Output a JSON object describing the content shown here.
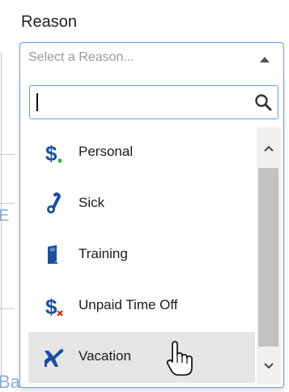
{
  "field": {
    "label": "Reason",
    "placeholder": "Select a Reason..."
  },
  "search": {
    "value": "",
    "icon": "search-icon"
  },
  "options": [
    {
      "label": "Personal",
      "icon": "dollar-dot-icon"
    },
    {
      "label": "Sick",
      "icon": "thermometer-icon"
    },
    {
      "label": "Training",
      "icon": "book-icon"
    },
    {
      "label": "Unpaid Time Off",
      "icon": "dollar-x-icon"
    },
    {
      "label": "Vacation",
      "icon": "airplane-icon",
      "hovered": true
    }
  ],
  "colors": {
    "accent": "#5aa0e8",
    "icon_blue": "#1b4f9c",
    "green_dot": "#3cb043",
    "red_x": "#d9261c",
    "hover_bg": "#e6e6e6"
  },
  "background_fragments": {
    "partial_text_left": "E",
    "partial_text_bottom": "Balance Detail"
  }
}
